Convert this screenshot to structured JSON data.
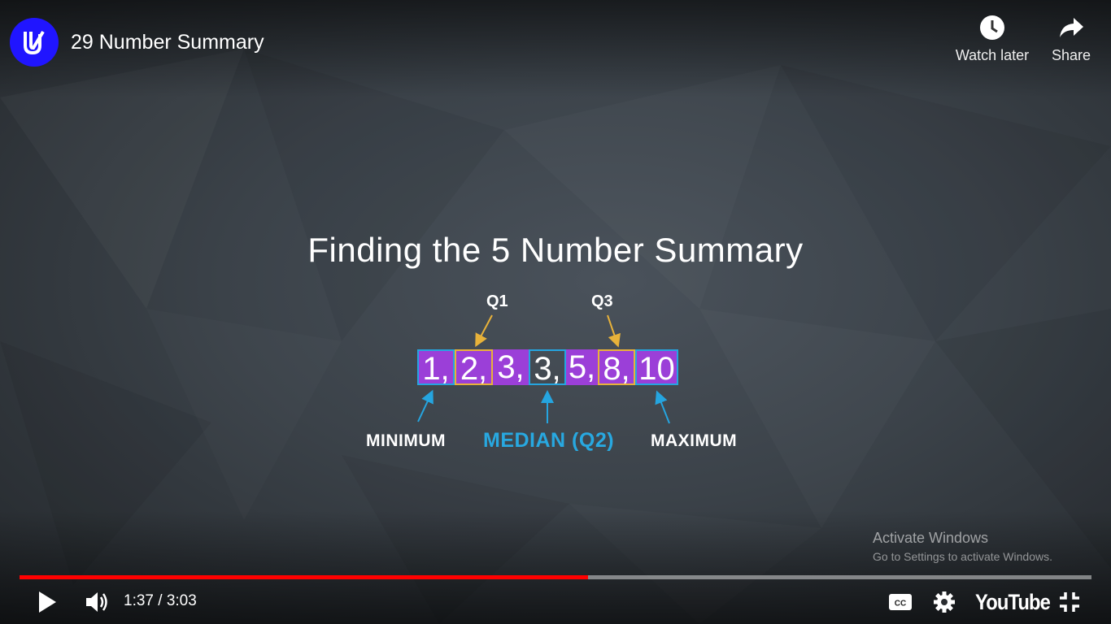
{
  "header": {
    "title": "29 Number Summary",
    "channel_logo_icon": "udacity-logo-icon",
    "watch_later_label": "Watch later",
    "share_label": "Share"
  },
  "slide": {
    "heading": "Finding the 5 Number Summary",
    "numbers": [
      "1,",
      "2,",
      "3,",
      "3,",
      "5,",
      "8,",
      "10"
    ],
    "q1_label": "Q1",
    "q3_label": "Q3",
    "minimum_label": "MINIMUM",
    "median_label": "MEDIAN (Q2)",
    "maximum_label": "MAXIMUM"
  },
  "watermark": {
    "title": "Activate Windows",
    "subtitle": "Go to Settings to activate Windows."
  },
  "controls": {
    "time": "1:37 / 3:03",
    "progress": 0.53,
    "youtube_label": "YouTube"
  },
  "colors": {
    "accent_red": "#ff0000",
    "purple": "#9b3fd8",
    "blue": "#25a5e0",
    "gold": "#e8b23a",
    "logo_blue": "#2015ff"
  }
}
